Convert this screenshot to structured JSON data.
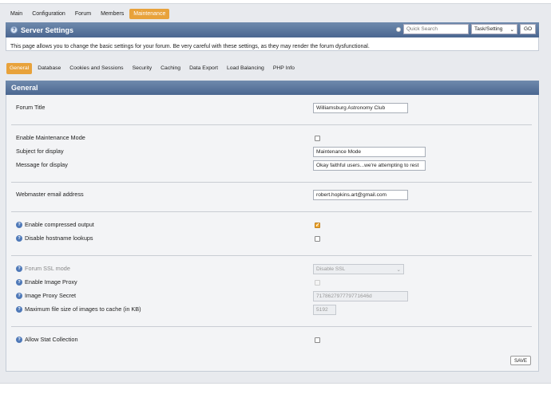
{
  "nav": {
    "tabs": [
      {
        "label": "Main"
      },
      {
        "label": "Configuration"
      },
      {
        "label": "Forum"
      },
      {
        "label": "Members"
      },
      {
        "label": "Maintenance"
      }
    ],
    "active_index": 4
  },
  "header": {
    "title": "Server Settings",
    "search_placeholder": "Quick Search",
    "task_select": "Task/Setting",
    "go_label": "GO"
  },
  "description": "This page allows you to change the basic settings for your forum. Be very careful with these settings, as they may render the forum dysfunctional.",
  "subtabs": {
    "items": [
      {
        "label": "General"
      },
      {
        "label": "Database"
      },
      {
        "label": "Cookies and Sessions"
      },
      {
        "label": "Security"
      },
      {
        "label": "Caching"
      },
      {
        "label": "Data Export"
      },
      {
        "label": "Load Balancing"
      },
      {
        "label": "PHP Info"
      }
    ],
    "active_index": 0
  },
  "general": {
    "title": "General",
    "forum_title_label": "Forum Title",
    "forum_title_value": "Williamsburg Astronomy Club",
    "maintenance_label": "Enable Maintenance Mode",
    "maintenance_checked": false,
    "subject_label": "Subject for display",
    "subject_value": "Maintenance Mode",
    "message_label": "Message for display",
    "message_value": "Okay faithful users...we're attempting to rest",
    "webmaster_label": "Webmaster email address",
    "webmaster_value": "robert.hopkins.art@gmail.com",
    "compressed_label": "Enable compressed output",
    "compressed_checked": true,
    "hostname_label": "Disable hostname lookups",
    "hostname_checked": false,
    "ssl_label": "Forum SSL mode",
    "ssl_value": "Disable SSL",
    "proxy_label": "Enable Image Proxy",
    "proxy_checked": false,
    "proxy_secret_label": "Image Proxy Secret",
    "proxy_secret_value": "717862797779771646d",
    "max_size_label": "Maximum file size of images to cache (in KB)",
    "max_size_value": "5192",
    "stat_label": "Allow Stat Collection",
    "stat_checked": false,
    "save_label": "SAVE"
  },
  "colors": {
    "accent": "#e8a23b",
    "header_bar": "#5b779f"
  }
}
